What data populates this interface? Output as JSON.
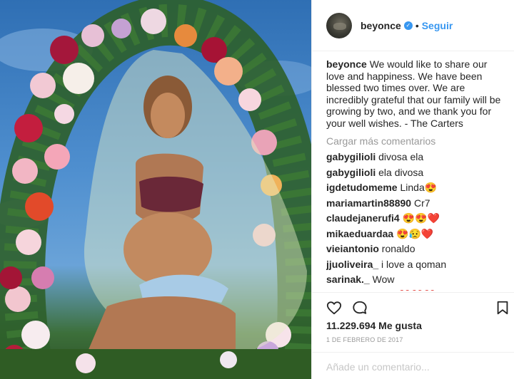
{
  "post": {
    "image_alt": "Maternity portrait with floral wreath and green veil"
  },
  "header": {
    "username": "beyonce",
    "verified": true,
    "separator": "•",
    "follow_label": "Seguir"
  },
  "caption": {
    "username": "beyonce",
    "text": "We would like to share our love and happiness. We have been blessed two times over. We are incredibly grateful that our family will be growing by two, and we thank you for your well wishes. - The Carters"
  },
  "load_more_label": "Cargar más comentarios",
  "comments": [
    {
      "user": "gabygilioli",
      "text": "divosa ela"
    },
    {
      "user": "gabygilioli",
      "text": "ela divosa"
    },
    {
      "user": "igdetudomeme",
      "text": "Linda😍"
    },
    {
      "user": "mariamartin88890",
      "text": "Cr7"
    },
    {
      "user": "claudejanerufi4",
      "text": "😍😍❤️"
    },
    {
      "user": "mikaeduardaa",
      "text": "😍😥❤️"
    },
    {
      "user": "vieiantonio",
      "text": "ronaldo"
    },
    {
      "user": "jjuoliveira_",
      "text": "i love a qoman"
    },
    {
      "user": "sarinak._",
      "text": "Wow"
    },
    {
      "user": "ossismcmaust",
      "text": "❤️❤️❤️"
    }
  ],
  "stats": {
    "likes": "11.229.694 Me gusta",
    "date": "1 DE FEBRERO DE 2017"
  },
  "add_comment_placeholder": "Añade un comentario...",
  "icons": {
    "like": "heart-icon",
    "comment": "comment-icon",
    "save": "bookmark-icon"
  },
  "colors": {
    "link_blue": "#3897f0",
    "text": "#262626",
    "muted": "#999999"
  }
}
